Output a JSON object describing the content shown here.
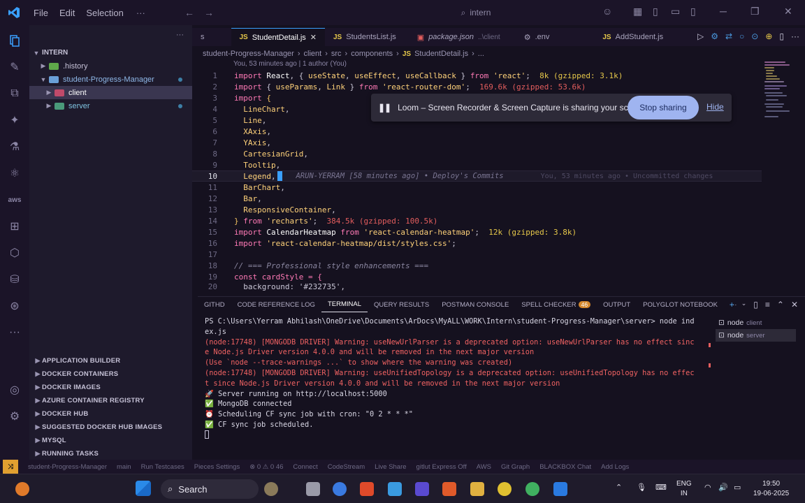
{
  "titlebar": {
    "menu": [
      "File",
      "Edit",
      "Selection"
    ],
    "more": "···",
    "search": "intern"
  },
  "sidebar": {
    "title": "INTERN",
    "tree": [
      {
        "label": ".history",
        "color": "#5fa84a"
      },
      {
        "label": "student-Progress-Manager",
        "color": "#6aa0d8"
      },
      {
        "label": "client",
        "color": "#c04a6a"
      },
      {
        "label": "server",
        "color": "#4a9a7a"
      }
    ],
    "sections": [
      "APPLICATION BUILDER",
      "DOCKER CONTAINERS",
      "DOCKER IMAGES",
      "AZURE CONTAINER REGISTRY",
      "DOCKER HUB",
      "SUGGESTED DOCKER HUB IMAGES",
      "MYSQL",
      "RUNNING TASKS"
    ]
  },
  "tabs": [
    {
      "label": "s",
      "badge": ""
    },
    {
      "label": "StudentDetail.js",
      "badge": "JS"
    },
    {
      "label": "StudentsList.js",
      "badge": "JS"
    },
    {
      "label": "package.json",
      "badge": "",
      "hint": "..\\client"
    },
    {
      "label": ".env",
      "badge": ""
    },
    {
      "label": "AddStudent.js",
      "badge": "JS"
    }
  ],
  "breadcrumb": [
    "student-Progress-Manager",
    "client",
    "src",
    "components",
    "JS",
    "StudentDetail.js",
    "..."
  ],
  "blame_top": "You, 53 minutes ago | 1 author (You)",
  "code": {
    "current_line": "10",
    "blame_inline": "ARUN-YERRAM [58 minutes ago] • Deploy's Commits",
    "blame_faded": "You, 53 minutes ago • Uncommitted changes",
    "size1": "8k (gzipped: 3.1k)",
    "size2": "169.6k (gzipped: 53.6k)",
    "size3": "384.5k (gzipped: 100.5k)",
    "size4": "12k (gzipped: 3.8k)",
    "comment": "// === Professional style enhancements ===",
    "l18": "const cardStyle = {",
    "l19": "  background: '#232735',"
  },
  "loom": {
    "message": "Loom – Screen Recorder & Screen Capture is sharing your screen.",
    "stop": "Stop sharing",
    "hide": "Hide"
  },
  "panel": {
    "tabs": [
      "GITHD",
      "CODE REFERENCE LOG",
      "TERMINAL",
      "QUERY RESULTS",
      "POSTMAN CONSOLE",
      "SPELL CHECKER",
      "OUTPUT",
      "POLYGLOT NOTEBOOK"
    ],
    "spell_count": "46",
    "terminal": [
      "PS C:\\Users\\Yerram Abhilash\\OneDrive\\Documents\\ArDocs\\MyALL\\WORK\\Intern\\student-Progress-Manager\\server> node ind",
      "ex.js",
      "(node:17748) [MONGODB DRIVER] Warning: useNewUrlParser is a deprecated option: useNewUrlParser has no effect sinc",
      "e Node.js Driver version 4.0.0 and will be removed in the next major version",
      "(Use `node --trace-warnings ...` to show where the warning was created)",
      "(node:17748) [MONGODB DRIVER] Warning: useUnifiedTopology is a deprecated option: useUnifiedTopology has no effec",
      "t since Node.js Driver version 4.0.0 and will be removed in the next major version",
      "🚀 Server running on http://localhost:5000",
      "✅ MongoDB connected",
      "⏰ Scheduling CF sync job with cron: \"0 2 * * *\"",
      "✅ CF sync job scheduled."
    ],
    "terminals": [
      {
        "name": "node",
        "sub": "client"
      },
      {
        "name": "node",
        "sub": "server"
      }
    ]
  },
  "statusbar": [
    "student-Progress-Manager",
    "main",
    "Run Testcases",
    "Pieces Settings",
    "⊗ 0 ⚠ 0 46",
    "Connect",
    "CodeStream",
    "Live Share",
    "gitlut Express Off",
    "AWS",
    "Git Graph",
    "BLACKBOX Chat",
    "Add Logs"
  ],
  "taskbar": {
    "search": "Search",
    "lang": "ENG",
    "region": "IN",
    "time": "19:50",
    "date": "19-06-2025"
  }
}
